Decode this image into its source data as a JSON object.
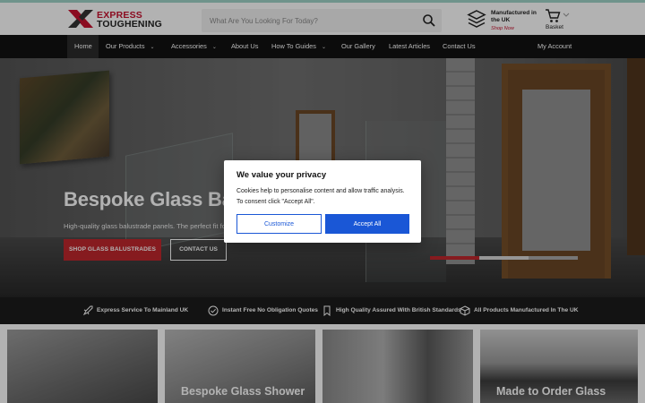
{
  "brand": {
    "line1": "EXPRESS",
    "line2": "TOUGHENING",
    "accent": "#c8102e"
  },
  "search": {
    "placeholder": "What Are You Looking For Today?",
    "icon": "search-icon"
  },
  "header": {
    "manufactured_title": "Manufactured in the UK",
    "manufactured_link": "Shop Now",
    "basket_label": "Basket"
  },
  "nav": {
    "items": [
      {
        "label": "Home",
        "active": true
      },
      {
        "label": "Our Products",
        "dropdown": true
      },
      {
        "label": "Accessories",
        "dropdown": true
      },
      {
        "label": "About Us"
      },
      {
        "label": "How To Guides",
        "dropdown": true
      },
      {
        "label": "Our Gallery"
      },
      {
        "label": "Latest Articles"
      },
      {
        "label": "Contact Us"
      },
      {
        "label": "My Account"
      }
    ]
  },
  "hero": {
    "title": "Bespoke Glass Balu",
    "subtitle": "High-quality glass balustrade panels. The perfect fit for o",
    "primary_cta": "SHOP GLASS BALUSTRADES",
    "secondary_cta": "CONTACT US",
    "slides": {
      "count": 3,
      "active": 1
    }
  },
  "trust": [
    {
      "label": "Express Service To Mainland UK",
      "icon": "rocket-icon"
    },
    {
      "label": "Instant Free No Obligation Quotes",
      "icon": "check-circle-icon"
    },
    {
      "label": "High Quality Assured With British Standards",
      "icon": "bookmark-icon"
    },
    {
      "label": "All Products Manufactured In The UK",
      "icon": "box-icon"
    }
  ],
  "cards": [
    {
      "label": ""
    },
    {
      "label": "Bespoke Glass Shower"
    },
    {
      "label": ""
    },
    {
      "label": "Made to Order Glass"
    }
  ],
  "cookie": {
    "title": "We value your privacy",
    "body": "Cookies help to personalise content and allow traffic analysis. To consent click \"Accept All\".",
    "customize": "Customize",
    "accept": "Accept All",
    "button_color": "#1a57d6"
  }
}
